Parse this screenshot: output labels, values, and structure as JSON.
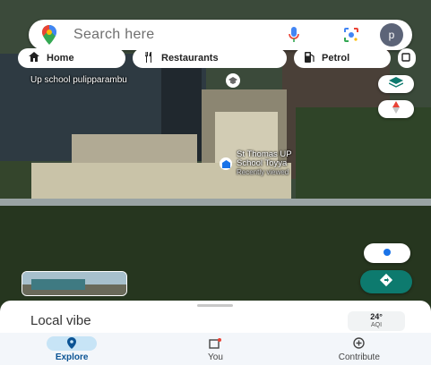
{
  "status_bar": {
    "left_text": "",
    "right_text": ""
  },
  "search": {
    "placeholder": "Search here",
    "avatar_initial": "p"
  },
  "chips": [
    {
      "label": "Home",
      "icon": "home-icon"
    },
    {
      "label": "Restaurants",
      "icon": "fork-knife-icon"
    },
    {
      "label": "Petrol",
      "icon": "fuel-icon"
    }
  ],
  "map": {
    "school_label": "Up school pulipparambu",
    "place_name_line1": "St Thomas UP",
    "place_name_line2": "School Toyya",
    "place_subtitle": "Recently viewed"
  },
  "bottom_sheet": {
    "title": "Local vibe",
    "weather_temp": "24°",
    "weather_aqi": "AQI"
  },
  "nav": [
    {
      "label": "Explore",
      "icon": "location-pin-icon",
      "active": true
    },
    {
      "label": "You",
      "icon": "saved-icon",
      "active": false
    },
    {
      "label": "Contribute",
      "icon": "add-circle-icon",
      "active": false
    }
  ],
  "colors": {
    "accent": "#0b5394",
    "directions_button": "#0d7a6e",
    "active_pill": "#c7e4f6"
  }
}
